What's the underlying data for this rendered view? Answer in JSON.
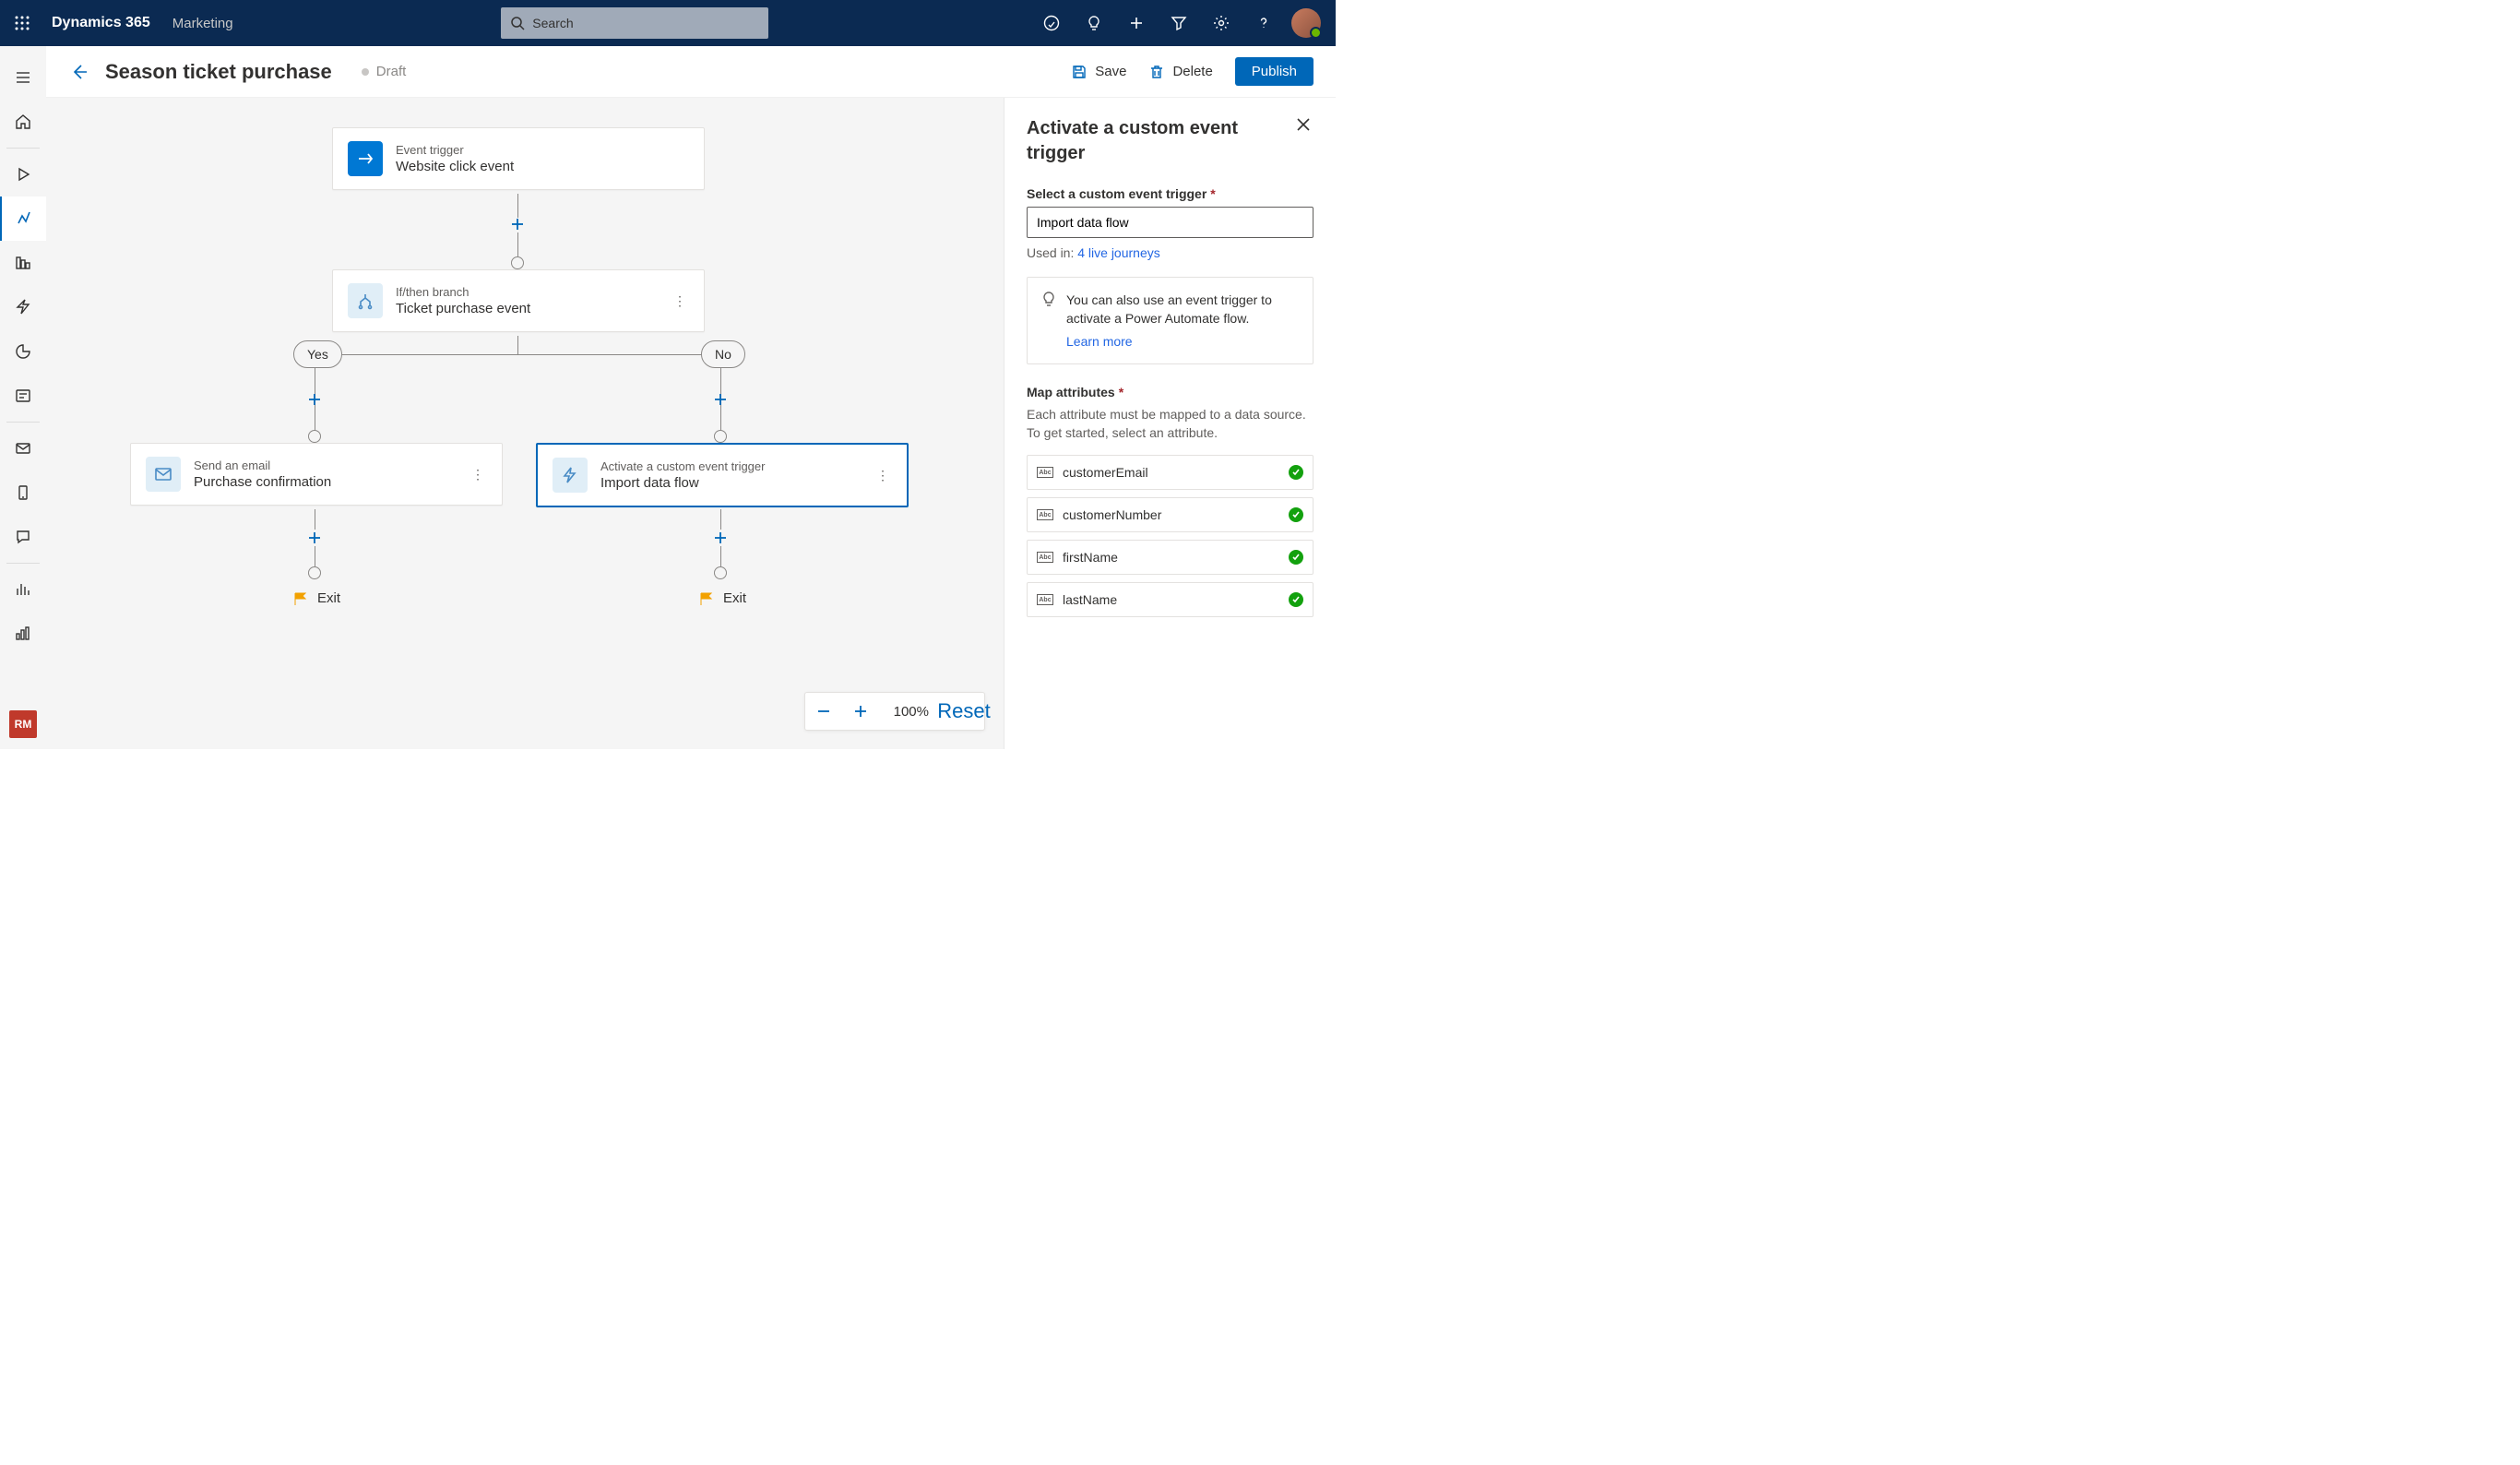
{
  "header": {
    "brand": "Dynamics 365",
    "breadcrumb": "Marketing",
    "search_placeholder": "Search"
  },
  "commandbar": {
    "page_title": "Season ticket purchase",
    "status": "Draft",
    "save_label": "Save",
    "delete_label": "Delete",
    "publish_label": "Publish"
  },
  "canvas": {
    "node_trigger": {
      "label": "Event trigger",
      "title": "Website click event"
    },
    "node_branch": {
      "label": "If/then branch",
      "title": "Ticket purchase event"
    },
    "branch_yes": "Yes",
    "branch_no": "No",
    "node_email": {
      "label": "Send an email",
      "title": "Purchase confirmation"
    },
    "node_custom": {
      "label": "Activate a custom event trigger",
      "title": "Import data flow"
    },
    "exit": "Exit"
  },
  "panel": {
    "title": "Activate a custom event trigger",
    "select_label": "Select a custom event trigger",
    "select_value": "Import data flow",
    "used_in_prefix": "Used in:",
    "used_in_link": "4 live journeys",
    "tip_text": "You can also use an event trigger to activate a Power Automate flow.",
    "learn_more": "Learn more",
    "map_label": "Map attributes",
    "map_helper": "Each attribute must be mapped to a data source. To get started, select an attribute.",
    "attributes": [
      {
        "name": "customerEmail"
      },
      {
        "name": "customerNumber"
      },
      {
        "name": "firstName"
      },
      {
        "name": "lastName"
      }
    ]
  },
  "zoom": {
    "level": "100%",
    "reset": "Reset"
  },
  "leftrail": {
    "rm": "RM"
  }
}
